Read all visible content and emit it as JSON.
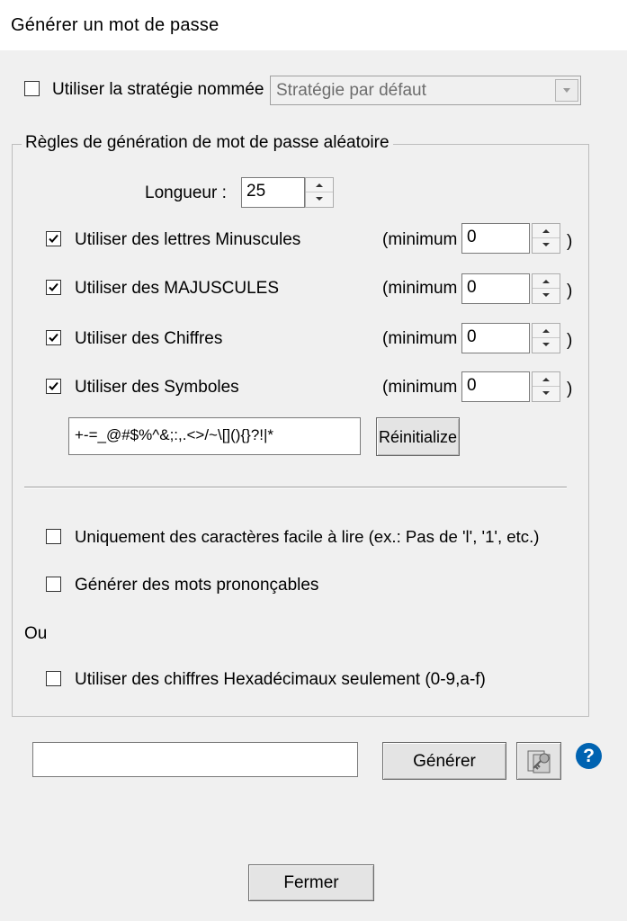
{
  "window": {
    "title": "Générer un mot de passe"
  },
  "strategy": {
    "checkbox_label": "Utiliser la stratégie nommée",
    "checked": false,
    "selected_value": "Stratégie par défaut"
  },
  "rules": {
    "group_title": "Règles de génération de mot de passe aléatoire",
    "length_label": "Longueur :",
    "length_value": "25",
    "minimum_label": "(minimum",
    "close_paren": ")",
    "options": [
      {
        "label": "Utiliser des lettres Minuscules",
        "checked": true,
        "minimum": "0"
      },
      {
        "label": "Utiliser des MAJUSCULES",
        "checked": true,
        "minimum": "0"
      },
      {
        "label": "Utiliser des Chiffres",
        "checked": true,
        "minimum": "0"
      },
      {
        "label": "Utiliser des Symboles",
        "checked": true,
        "minimum": "0"
      }
    ],
    "symbols_value": "+-=_@#$%^&;:,.<>/~\\[](){}?!|*",
    "reset_label": "Réinitialize",
    "easy_read_label": "Uniquement des caractères facile à lire (ex.: Pas de 'l', '1', etc.)",
    "easy_read_checked": false,
    "pronounceable_label": "Générer des mots prononçables",
    "pronounceable_checked": false,
    "or_label": "Ou",
    "hex_label": "Utiliser des chiffres Hexadécimaux seulement (0-9,a-f)",
    "hex_checked": false
  },
  "generate": {
    "output_value": "",
    "button_label": "Générer",
    "copy_icon": "key-copy-icon",
    "help_icon": "help-icon",
    "help_color": "#0063b1"
  },
  "footer": {
    "close_label": "Fermer"
  }
}
